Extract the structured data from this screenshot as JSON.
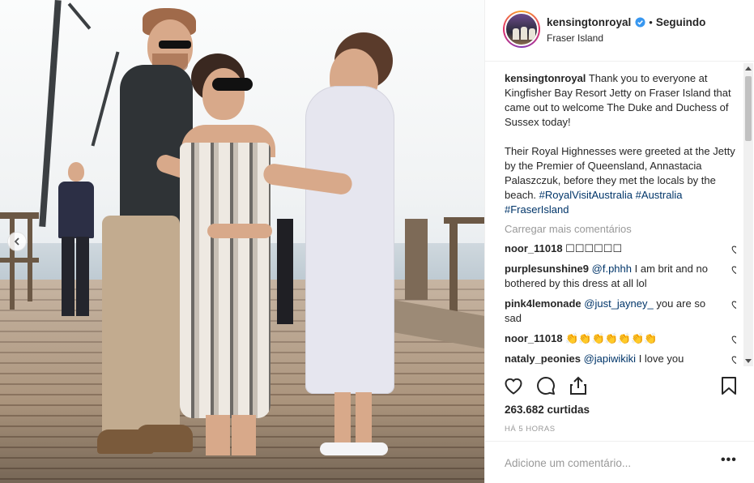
{
  "post": {
    "username": "kensingtonroyal",
    "follow_status": "Seguindo",
    "location": "Fraser Island",
    "caption_prefix": "Thank you to everyone at Kingfisher Bay Resort Jetty on Fraser Island that came out to welcome The Duke and Duchess of Sussex today!",
    "caption_body": "Their Royal Highnesses were greeted at the Jetty by the Premier of Queensland, Annastacia Palaszczuk, before they met the locals by the beach.",
    "hashtags": [
      "#RoyalVisitAustralia",
      "#Australia",
      "#FraserIsland"
    ],
    "load_more": "Carregar mais comentários",
    "likes": "263.682 curtidas",
    "time_ago": "HÁ 5 HORAS",
    "add_comment_placeholder": "Adicione um comentário...",
    "more_label": "•••"
  },
  "comments": [
    {
      "user": "noor_11018",
      "mention": "",
      "text": "☐☐☐☐☐☐"
    },
    {
      "user": "purplesunshine9",
      "mention": "@f.phhh",
      "text": "I am brit and no bothered by this dress at all lol"
    },
    {
      "user": "pink4lemonade",
      "mention": "@just_jayney_",
      "text": "you are so sad"
    },
    {
      "user": "noor_11018",
      "mention": "",
      "text": "👏👏👏👏👏👏👏"
    },
    {
      "user": "nataly_peonies",
      "mention": "@japiwikiki",
      "text": "I love you"
    }
  ],
  "colors": {
    "link": "#003569",
    "muted": "#999999",
    "verified": "#3897f0"
  },
  "icons": [
    "heart-icon",
    "comment-icon",
    "share-icon",
    "bookmark-icon",
    "verified-badge-icon",
    "chevron-left-icon"
  ]
}
